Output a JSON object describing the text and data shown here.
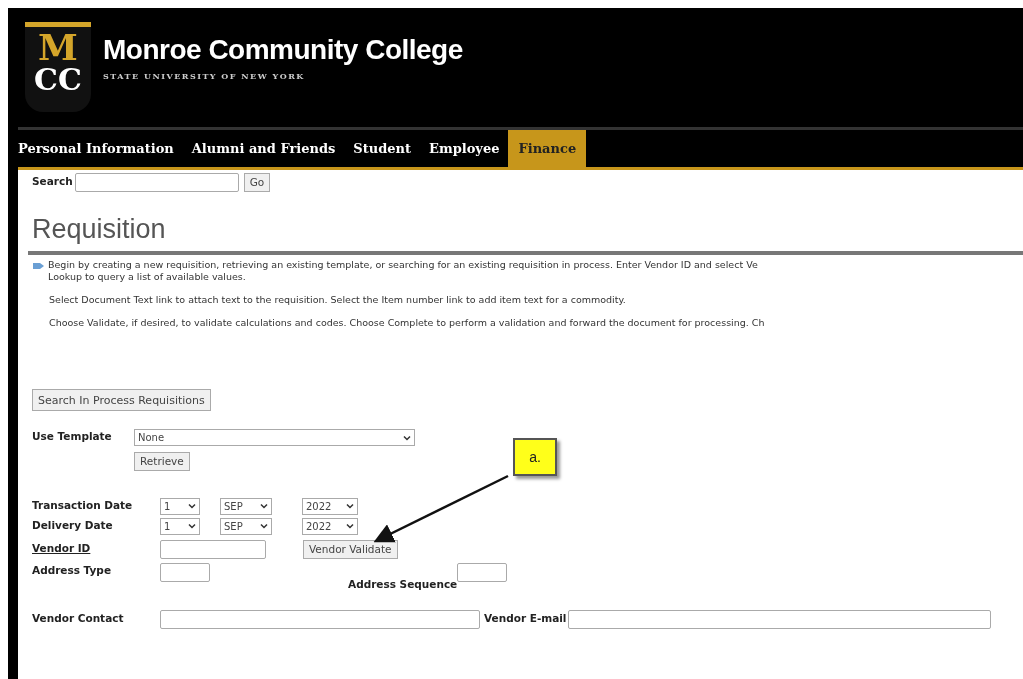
{
  "header": {
    "logo_top": "M",
    "logo_bottom": "CC",
    "title": "Monroe Community College",
    "subtitle": "STATE UNIVERSITY OF NEW YORK"
  },
  "nav": [
    {
      "label": "Personal Information",
      "selected": false
    },
    {
      "label": "Alumni and Friends",
      "selected": false
    },
    {
      "label": "Student",
      "selected": false
    },
    {
      "label": "Employee",
      "selected": false
    },
    {
      "label": "Finance",
      "selected": true
    }
  ],
  "search": {
    "label": "Search",
    "button": "Go"
  },
  "page_title": "Requisition",
  "instructions": [
    [
      "Begin by creating a new requisition, retrieving an existing template, or searching for an existing requisition in process. Enter Vendor ID and select Ve",
      "Lookup to query a list of available values."
    ],
    [
      "Select Document Text link to attach text to the requisition. Select the Item number link to add item text for a commodity."
    ],
    [
      "Choose Validate, if desired, to validate calculations and codes. Choose Complete to perform a validation and forward the document for processing. Ch"
    ]
  ],
  "search_in_process_button": "Search In Process Requisitions",
  "use_template": {
    "label": "Use Template",
    "value": "None",
    "button": "Retrieve"
  },
  "dates": [
    {
      "label": "Transaction Date",
      "day": "1",
      "month": "SEP",
      "year": "2022"
    },
    {
      "label": "Delivery Date",
      "day": "1",
      "month": "SEP",
      "year": "2022"
    }
  ],
  "vendor_id": {
    "label": "Vendor ID",
    "button": "Vendor Validate"
  },
  "address_type": {
    "label": "Address Type"
  },
  "address_sequence": {
    "label": "Address Sequence"
  },
  "vendor_contact": {
    "label": "Vendor Contact"
  },
  "vendor_email": {
    "label": "Vendor E-mail"
  },
  "callout": {
    "label": "a."
  }
}
